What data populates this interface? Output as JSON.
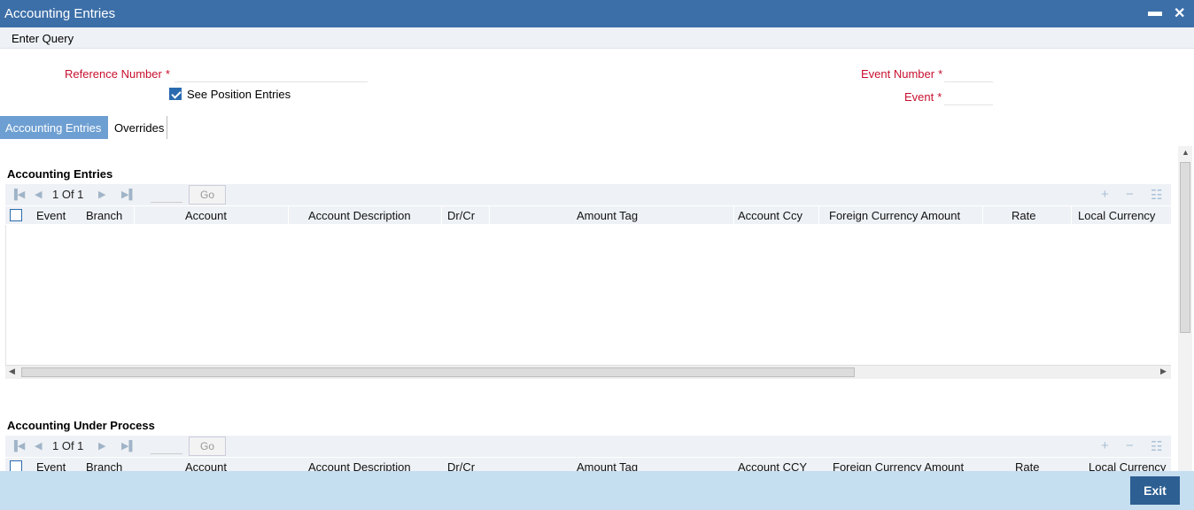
{
  "window": {
    "title": "Accounting Entries",
    "minimize_glyph": "▬",
    "close_glyph": "✕"
  },
  "menu": {
    "enter_query": "Enter Query"
  },
  "form": {
    "reference_number_label": "Reference Number",
    "required_marker": "*",
    "see_position_entries_label": "See Position Entries",
    "see_position_entries_checked": true,
    "event_number_label": "Event Number",
    "event_label": "Event",
    "reference_number_value": "",
    "event_number_value": "",
    "event_value": ""
  },
  "tabs": [
    {
      "label": "Accounting Entries",
      "active": true
    },
    {
      "label": "Overrides",
      "active": false
    }
  ],
  "accounting_entries": {
    "title": "Accounting Entries",
    "pager": {
      "page_text": "1 Of 1",
      "go_label": "Go"
    },
    "columns": [
      "Event",
      "Branch",
      "Account",
      "Account Description",
      "Dr/Cr",
      "Amount Tag",
      "Account Ccy",
      "Foreign Currency Amount",
      "Rate",
      "Local Currency"
    ]
  },
  "accounting_under_process": {
    "title": "Accounting Under Process",
    "pager": {
      "page_text": "1 Of 1",
      "go_label": "Go"
    },
    "columns": [
      "Event",
      "Branch",
      "Account",
      "Account Description",
      "Dr/Cr",
      "Amount Tag",
      "Account CCY",
      "Foreign Currency Amount",
      "Rate",
      "Local Currency"
    ]
  },
  "footer": {
    "exit_label": "Exit"
  },
  "icons": {
    "first_page": "first-page-icon",
    "prev_page": "previous-page-icon",
    "next_page": "next-page-icon",
    "last_page": "last-page-icon",
    "add_row": "add-row-icon",
    "delete_row": "delete-row-icon",
    "single_view": "single-view-icon"
  },
  "colors": {
    "titlebar": "#3c6fa8",
    "required_label": "#c8102e",
    "active_tab": "#6e9fd2",
    "footer": "#c5def0",
    "exit_button": "#2d5f92"
  }
}
